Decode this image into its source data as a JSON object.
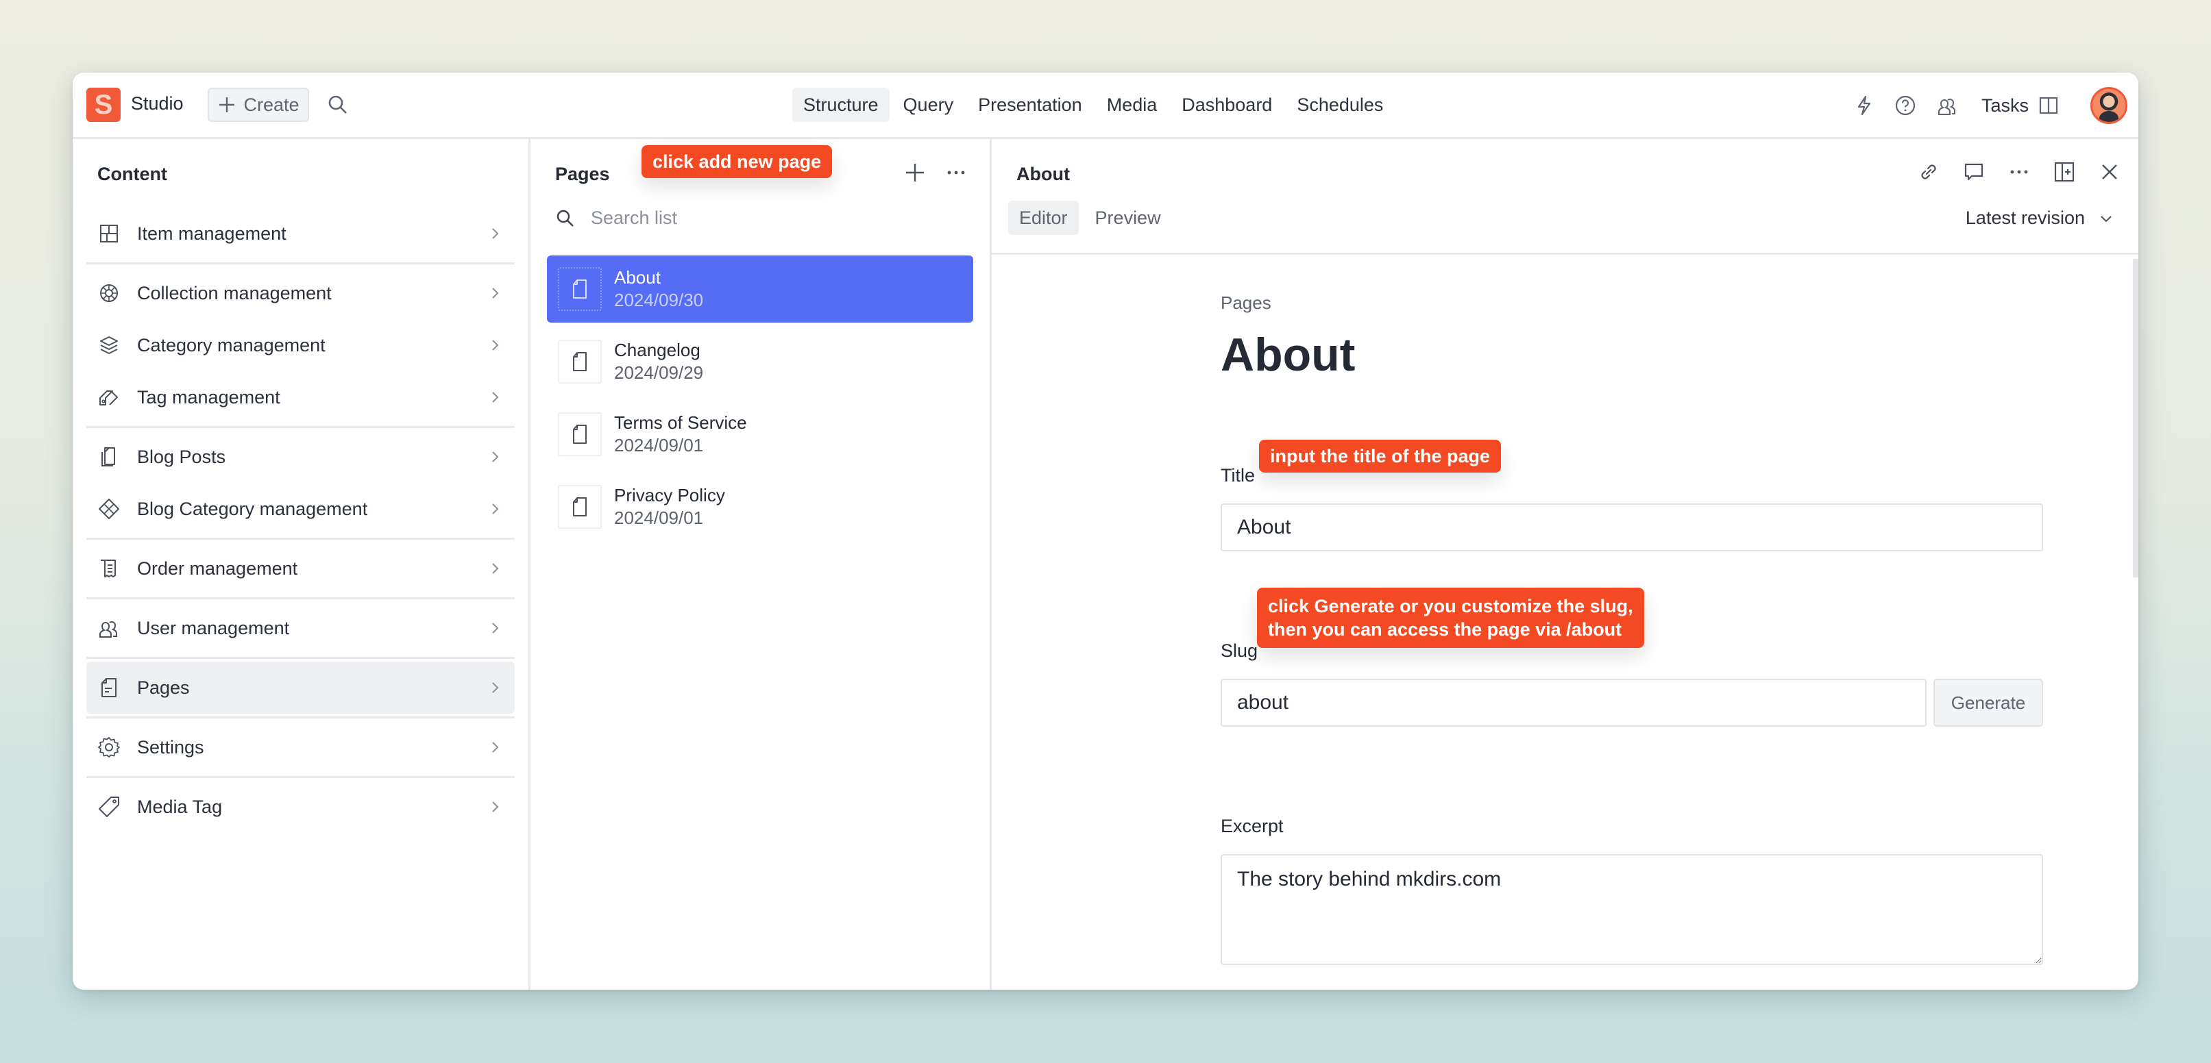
{
  "app": {
    "name": "Studio",
    "logo_letter": "S",
    "create_label": "Create",
    "brand_color": "#f15a38"
  },
  "nav": {
    "items": [
      {
        "label": "Structure",
        "active": true
      },
      {
        "label": "Query"
      },
      {
        "label": "Presentation"
      },
      {
        "label": "Media"
      },
      {
        "label": "Dashboard"
      },
      {
        "label": "Schedules"
      }
    ]
  },
  "top_right": {
    "tasks_label": "Tasks",
    "icons": [
      "lightning-icon",
      "help-icon",
      "users-icon",
      "panel-icon",
      "avatar"
    ]
  },
  "sidebar": {
    "title": "Content",
    "items": [
      {
        "label": "Item management",
        "icon": "grid-icon"
      },
      {
        "label": "Collection management",
        "icon": "wheel-icon"
      },
      {
        "label": "Category management",
        "icon": "layers-icon"
      },
      {
        "label": "Tag management",
        "icon": "tags-icon"
      },
      {
        "label": "Blog Posts",
        "icon": "documents-icon"
      },
      {
        "label": "Blog Category management",
        "icon": "diamond-icon"
      },
      {
        "label": "Order management",
        "icon": "receipt-icon"
      },
      {
        "label": "User management",
        "icon": "users-icon"
      },
      {
        "label": "Pages",
        "icon": "page-icon",
        "active": true
      },
      {
        "label": "Settings",
        "icon": "gear-icon"
      },
      {
        "label": "Media Tag",
        "icon": "tag-icon"
      }
    ]
  },
  "list": {
    "title": "Pages",
    "search_placeholder": "Search list",
    "items": [
      {
        "title": "About",
        "date": "2024/09/30",
        "selected": true
      },
      {
        "title": "Changelog",
        "date": "2024/09/29"
      },
      {
        "title": "Terms of Service",
        "date": "2024/09/01"
      },
      {
        "title": "Privacy Policy",
        "date": "2024/09/01"
      }
    ],
    "selected_color": "#556cf5"
  },
  "editor": {
    "title": "About",
    "tabs": [
      {
        "label": "Editor",
        "active": true
      },
      {
        "label": "Preview"
      }
    ],
    "revision_label": "Latest revision",
    "breadcrumb": "Pages",
    "heading": "About",
    "fields": {
      "title": {
        "label": "Title",
        "value": "About"
      },
      "slug": {
        "label": "Slug",
        "value": "about",
        "button": "Generate"
      },
      "excerpt": {
        "label": "Excerpt",
        "value": "The story behind mkdirs.com"
      }
    }
  },
  "annotations": {
    "color": "#f34a23",
    "add_page": "click add new page",
    "title_hint": "input the title of the page",
    "slug_hint_line1": "click Generate or you customize the slug,",
    "slug_hint_line2": "then you can access the page via /about"
  }
}
